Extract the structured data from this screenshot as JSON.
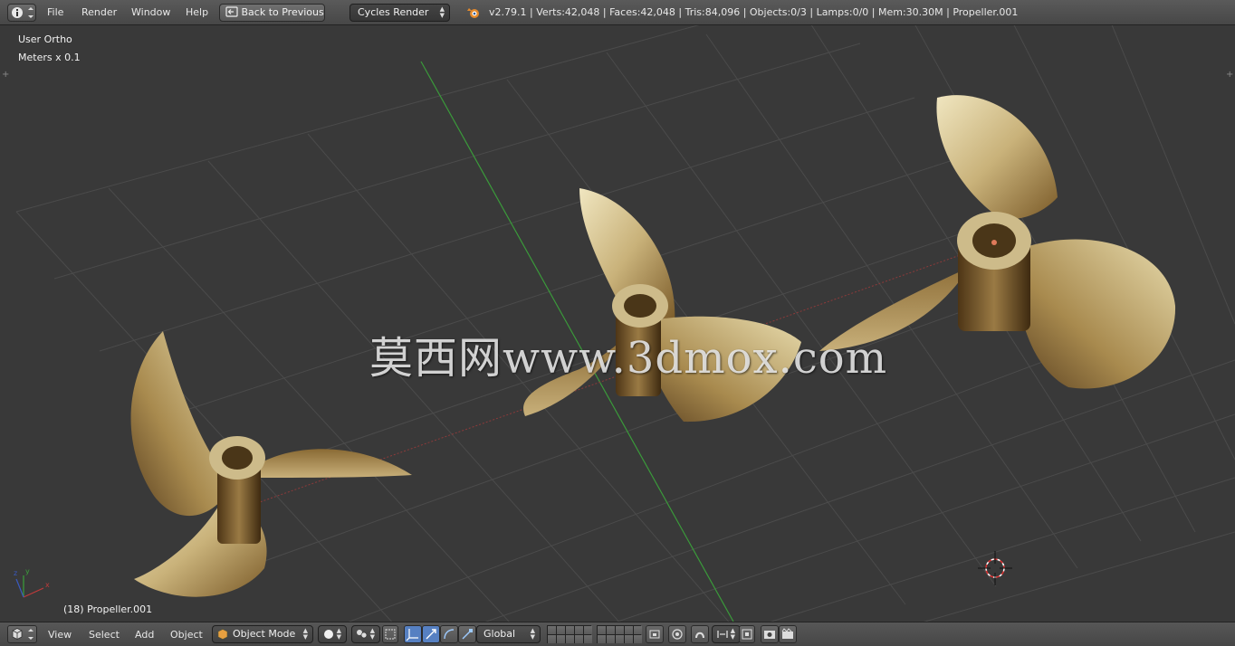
{
  "topbar": {
    "menus": [
      "File",
      "Render",
      "Window",
      "Help"
    ],
    "back_button": "Back to Previous",
    "render_engine": "Cycles Render",
    "stats": "v2.79.1 | Verts:42,048 | Faces:42,048 | Tris:84,096 | Objects:0/3 | Lamps:0/0 | Mem:30.30M | Propeller.001"
  },
  "viewport": {
    "view_name": "User Ortho",
    "unit_scale": "Meters x 0.1",
    "active_object": "(18) Propeller.001",
    "watermark": "莫西网www.3dmox.com",
    "axis_labels": {
      "x": "x",
      "y": "y",
      "z": "z"
    }
  },
  "bottombar": {
    "menus": [
      "View",
      "Select",
      "Add",
      "Object"
    ],
    "mode": "Object Mode",
    "orientation": "Global"
  },
  "colors": {
    "brass_light": "#e9dcae",
    "brass_mid": "#b39a5e",
    "brass_dark": "#5e4520",
    "grid": "#4a4a4a",
    "y_axis": "#3a9a3a",
    "x_axis": "#9a3a3a"
  },
  "icons": [
    "info-icon",
    "blender-logo-icon",
    "cube-icon",
    "object-mode-icon",
    "sphere-shading-icon",
    "pivot-icon",
    "manipulator-icon",
    "translate-icon",
    "rotate-icon",
    "scale-icon",
    "snap-icon",
    "proportional-icon",
    "render-icon",
    "camera-icon"
  ]
}
